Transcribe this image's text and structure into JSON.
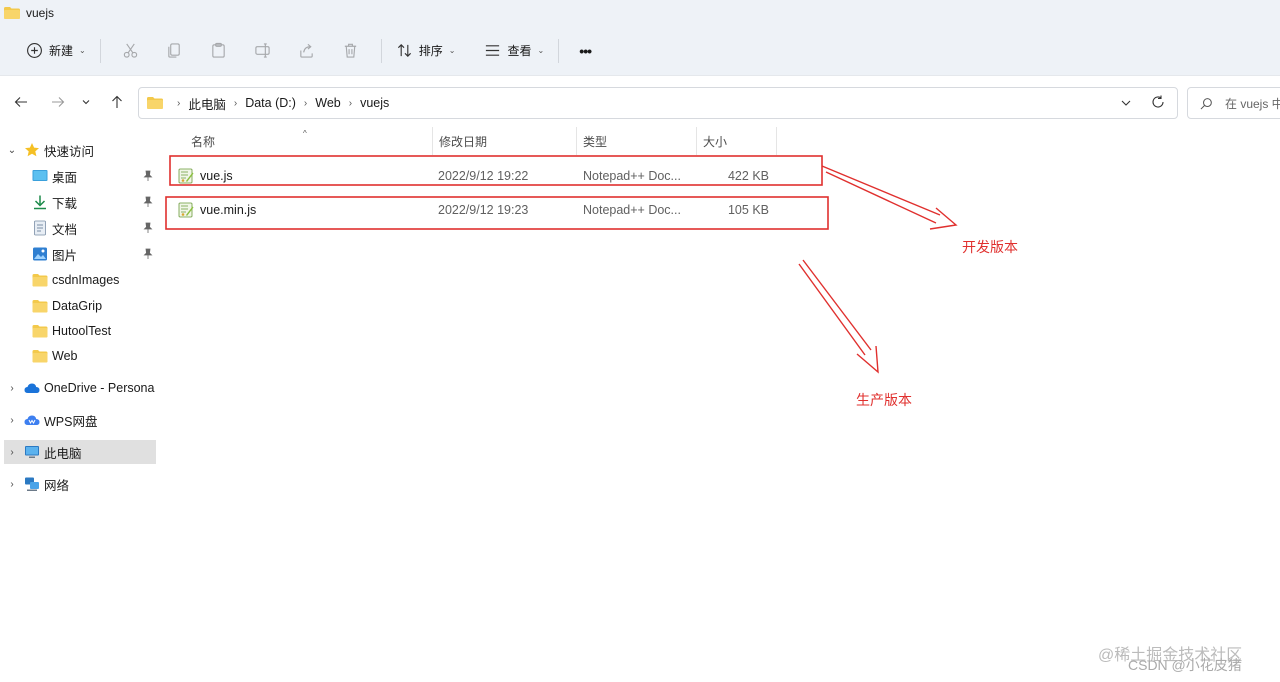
{
  "window": {
    "title": "vuejs"
  },
  "toolbar": {
    "new_label": "新建",
    "sort_label": "排序",
    "view_label": "查看",
    "more_label": "•••"
  },
  "address": {
    "crumbs": [
      "此电脑",
      "Data (D:)",
      "Web",
      "vuejs"
    ],
    "search_placeholder": "在 vuejs 中"
  },
  "sidebar": {
    "quick_access": "快速访问",
    "items": [
      {
        "label": "桌面",
        "icon": "desktop-icon",
        "pinned": true
      },
      {
        "label": "下载",
        "icon": "download-icon",
        "pinned": true
      },
      {
        "label": "文档",
        "icon": "document-icon",
        "pinned": true
      },
      {
        "label": "图片",
        "icon": "picture-icon",
        "pinned": true
      },
      {
        "label": "csdnImages",
        "icon": "folder-icon",
        "pinned": false
      },
      {
        "label": "DataGrip",
        "icon": "folder-icon",
        "pinned": false
      },
      {
        "label": "HutoolTest",
        "icon": "folder-icon",
        "pinned": false
      },
      {
        "label": "Web",
        "icon": "folder-icon",
        "pinned": false
      }
    ],
    "onedrive": "OneDrive - Persona",
    "wps": "WPS网盘",
    "this_pc": "此电脑",
    "network": "网络"
  },
  "columns": {
    "name": "名称",
    "date": "修改日期",
    "type": "类型",
    "size": "大小"
  },
  "files": [
    {
      "name": "vue.js",
      "date": "2022/9/12 19:22",
      "type": "Notepad++ Doc...",
      "size": "422 KB"
    },
    {
      "name": "vue.min.js",
      "date": "2022/9/12 19:23",
      "type": "Notepad++ Doc...",
      "size": "105 KB"
    }
  ],
  "annotations": {
    "dev": "开发版本",
    "prod": "生产版本"
  },
  "watermark": {
    "line1": "@稀土掘金技术社区",
    "line2": "CSDN @小花皮猪"
  },
  "colors": {
    "annotation": "#e0302e",
    "accent": "#0067c0",
    "folder": "#f3c94b"
  }
}
